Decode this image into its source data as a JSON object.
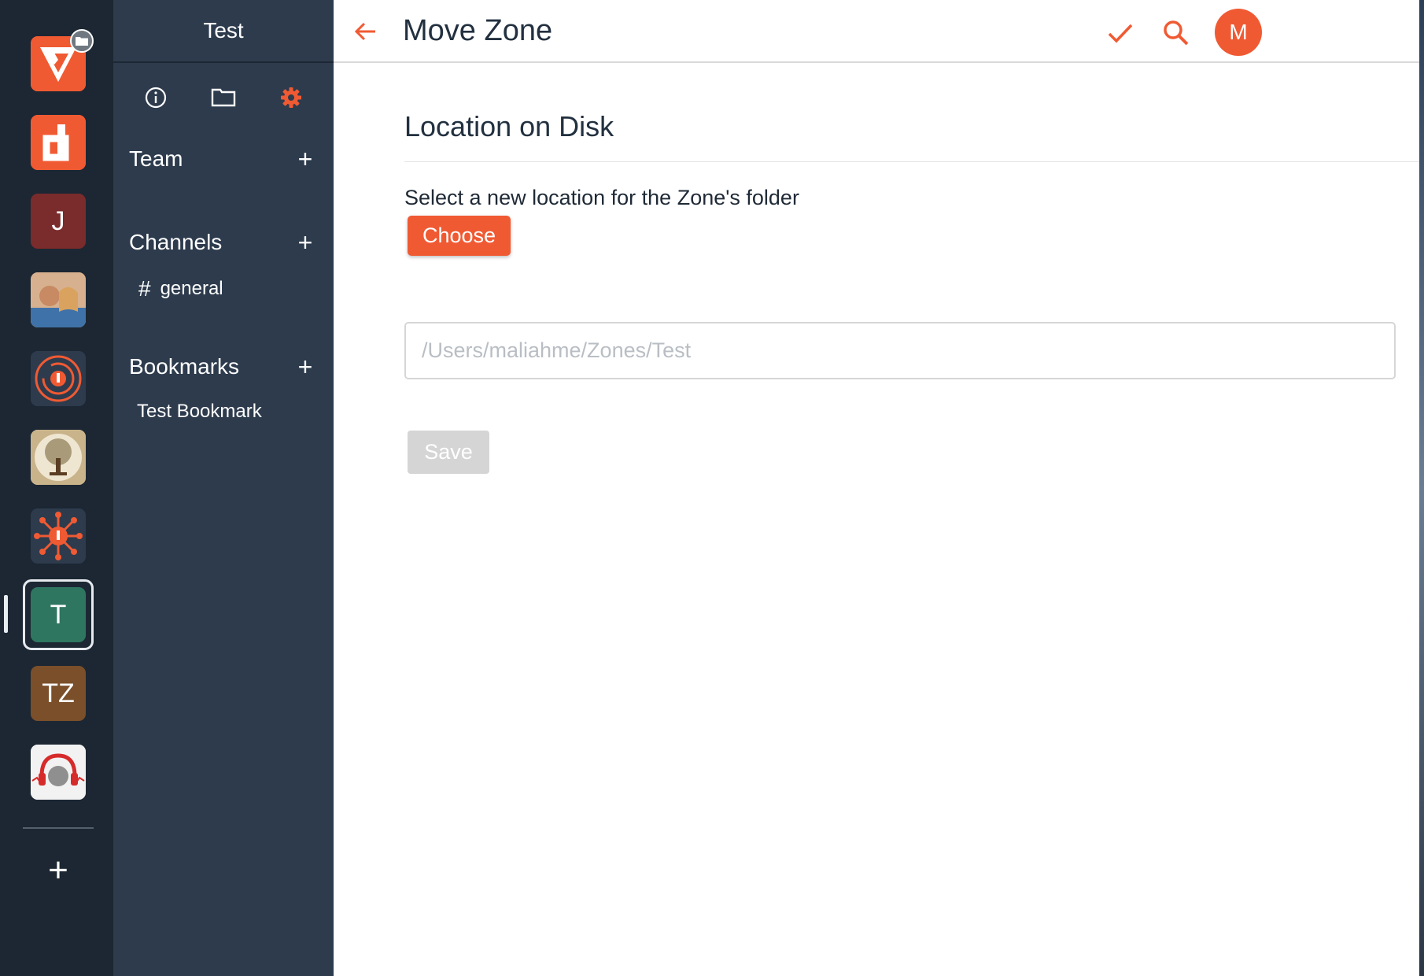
{
  "window": {
    "active_zone": "Test"
  },
  "rail": {
    "zones": [
      {
        "name": "vosk-zone",
        "letter": "",
        "color": "#f05a33",
        "icon": "zone-logo-v-icon"
      },
      {
        "name": "d-zone",
        "letter": "",
        "color": "#f05a33",
        "icon": "zone-logo-d-icon"
      },
      {
        "name": "j-zone",
        "letter": "J",
        "color": "#7a2b2b"
      },
      {
        "name": "photo-zone",
        "letter": "",
        "color": "#c98b5a",
        "icon": "photo-avatar-icon"
      },
      {
        "name": "ring-zone",
        "letter": "",
        "color": "#2d3b4d",
        "icon": "ring-logo-icon"
      },
      {
        "name": "tree-zone",
        "letter": "",
        "color": "#e9dcc0",
        "icon": "tree-logo-icon"
      },
      {
        "name": "network-zone",
        "letter": "",
        "color": "#2d3b4d",
        "icon": "network-logo-icon"
      },
      {
        "name": "t-zone",
        "letter": "T",
        "color": "#2f7661"
      },
      {
        "name": "tz-zone",
        "letter": "TZ",
        "color": "#7a4f2a"
      },
      {
        "name": "headphones-zone",
        "letter": "",
        "color": "#f2f2f2",
        "icon": "headphones-globe-icon"
      }
    ],
    "add_label": "+"
  },
  "sidebar": {
    "title": "Test",
    "tabs": [
      {
        "name": "info",
        "icon": "info-icon"
      },
      {
        "name": "files",
        "icon": "folder-icon"
      },
      {
        "name": "settings",
        "icon": "gear-icon",
        "active": true
      }
    ],
    "sections": {
      "team": {
        "title": "Team",
        "add": "+"
      },
      "channels": {
        "title": "Channels",
        "add": "+",
        "items": [
          {
            "hash": "#",
            "label": "general"
          }
        ]
      },
      "bookmarks": {
        "title": "Bookmarks",
        "add": "+",
        "items": [
          {
            "label": "Test Bookmark"
          }
        ]
      }
    }
  },
  "main": {
    "title": "Move Zone",
    "section_heading": "Location on Disk",
    "instruction": "Select a new location for the Zone's folder",
    "choose_label": "Choose",
    "path_placeholder": "/Users/maliahme/Zones/Test",
    "path_value": "",
    "save_label": "Save",
    "save_enabled": false,
    "avatar_initial": "M"
  },
  "colors": {
    "accent": "#f05a33",
    "rail_bg": "#1c2733",
    "sidebar_bg": "#2d3b4d",
    "disabled": "#d5d5d5"
  }
}
